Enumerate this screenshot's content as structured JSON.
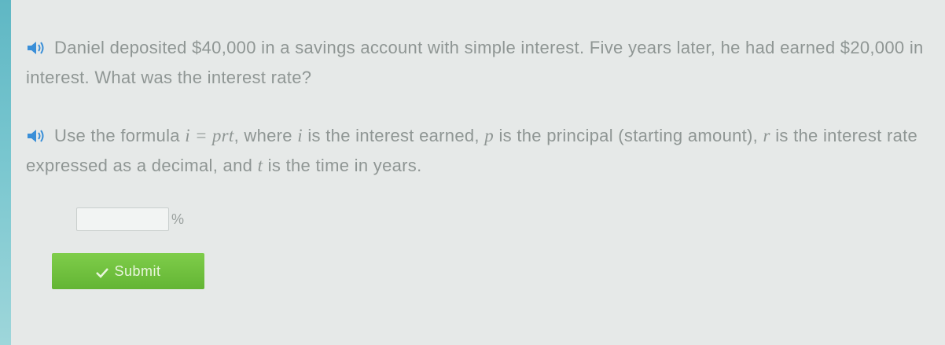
{
  "question": {
    "text": "Daniel deposited $40,000 in a savings account with simple interest. Five years later, he had earned $20,000 in interest. What was the interest rate?"
  },
  "hint": {
    "lead": "Use the formula ",
    "formula": "i = prt",
    "t1": ", where ",
    "v1": "i",
    "t2": " is the interest earned, ",
    "v2": "p",
    "t3": " is the principal (starting amount), ",
    "v3": "r",
    "t4": " is the interest rate expressed as a decimal, and ",
    "v4": "t",
    "t5": " is the time in years."
  },
  "answer": {
    "value": "",
    "unit": "%"
  },
  "submit": {
    "label": "Submit"
  },
  "colors": {
    "accent_green": "#6cc23c",
    "speaker_blue": "#3a8fd8",
    "left_strip": "#6dbdc9"
  },
  "icons": {
    "speaker": "speaker-icon",
    "check": "check-icon"
  }
}
